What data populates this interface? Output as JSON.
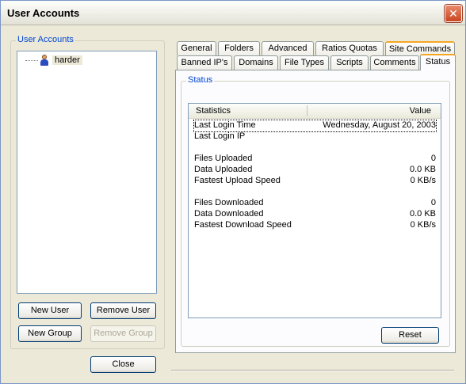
{
  "window": {
    "title": "User Accounts",
    "close_symbol": "✕"
  },
  "accounts_group": {
    "legend": "User Accounts",
    "users": [
      {
        "name": "harder"
      }
    ]
  },
  "buttons": {
    "new_user": "New User",
    "remove_user": "Remove User",
    "new_group": "New Group",
    "remove_group": "Remove Group",
    "close": "Close",
    "reset": "Reset"
  },
  "tabs": {
    "row_back": [
      "General",
      "Folders",
      "Advanced",
      "Ratios  Quotas",
      "Site Commands"
    ],
    "row_front": [
      "Banned IP's",
      "Domains",
      "File Types",
      "Scripts",
      "Comments",
      "Status"
    ],
    "active": "Status"
  },
  "status_group": {
    "legend": "Status",
    "columns": {
      "name": "Statistics",
      "value": "Value"
    },
    "rows": [
      {
        "key": "Last Login Time",
        "value": "Wednesday, August 20, 2003"
      },
      {
        "key": "Last Login IP",
        "value": ""
      },
      {
        "key": "Files Uploaded",
        "value": "0"
      },
      {
        "key": "Data Uploaded",
        "value": "0.0 KB"
      },
      {
        "key": "Fastest Upload Speed",
        "value": "0 KB/s"
      },
      {
        "key": "Files Downloaded",
        "value": "0"
      },
      {
        "key": "Data Downloaded",
        "value": "0.0 KB"
      },
      {
        "key": "Fastest Download Speed",
        "value": "0 KB/s"
      }
    ]
  },
  "colors": {
    "accent": "#0046d5",
    "tab_highlight": "#f5a623",
    "close_button": "#c9461e"
  },
  "icons": {
    "user": "user-icon",
    "close": "close-icon"
  }
}
